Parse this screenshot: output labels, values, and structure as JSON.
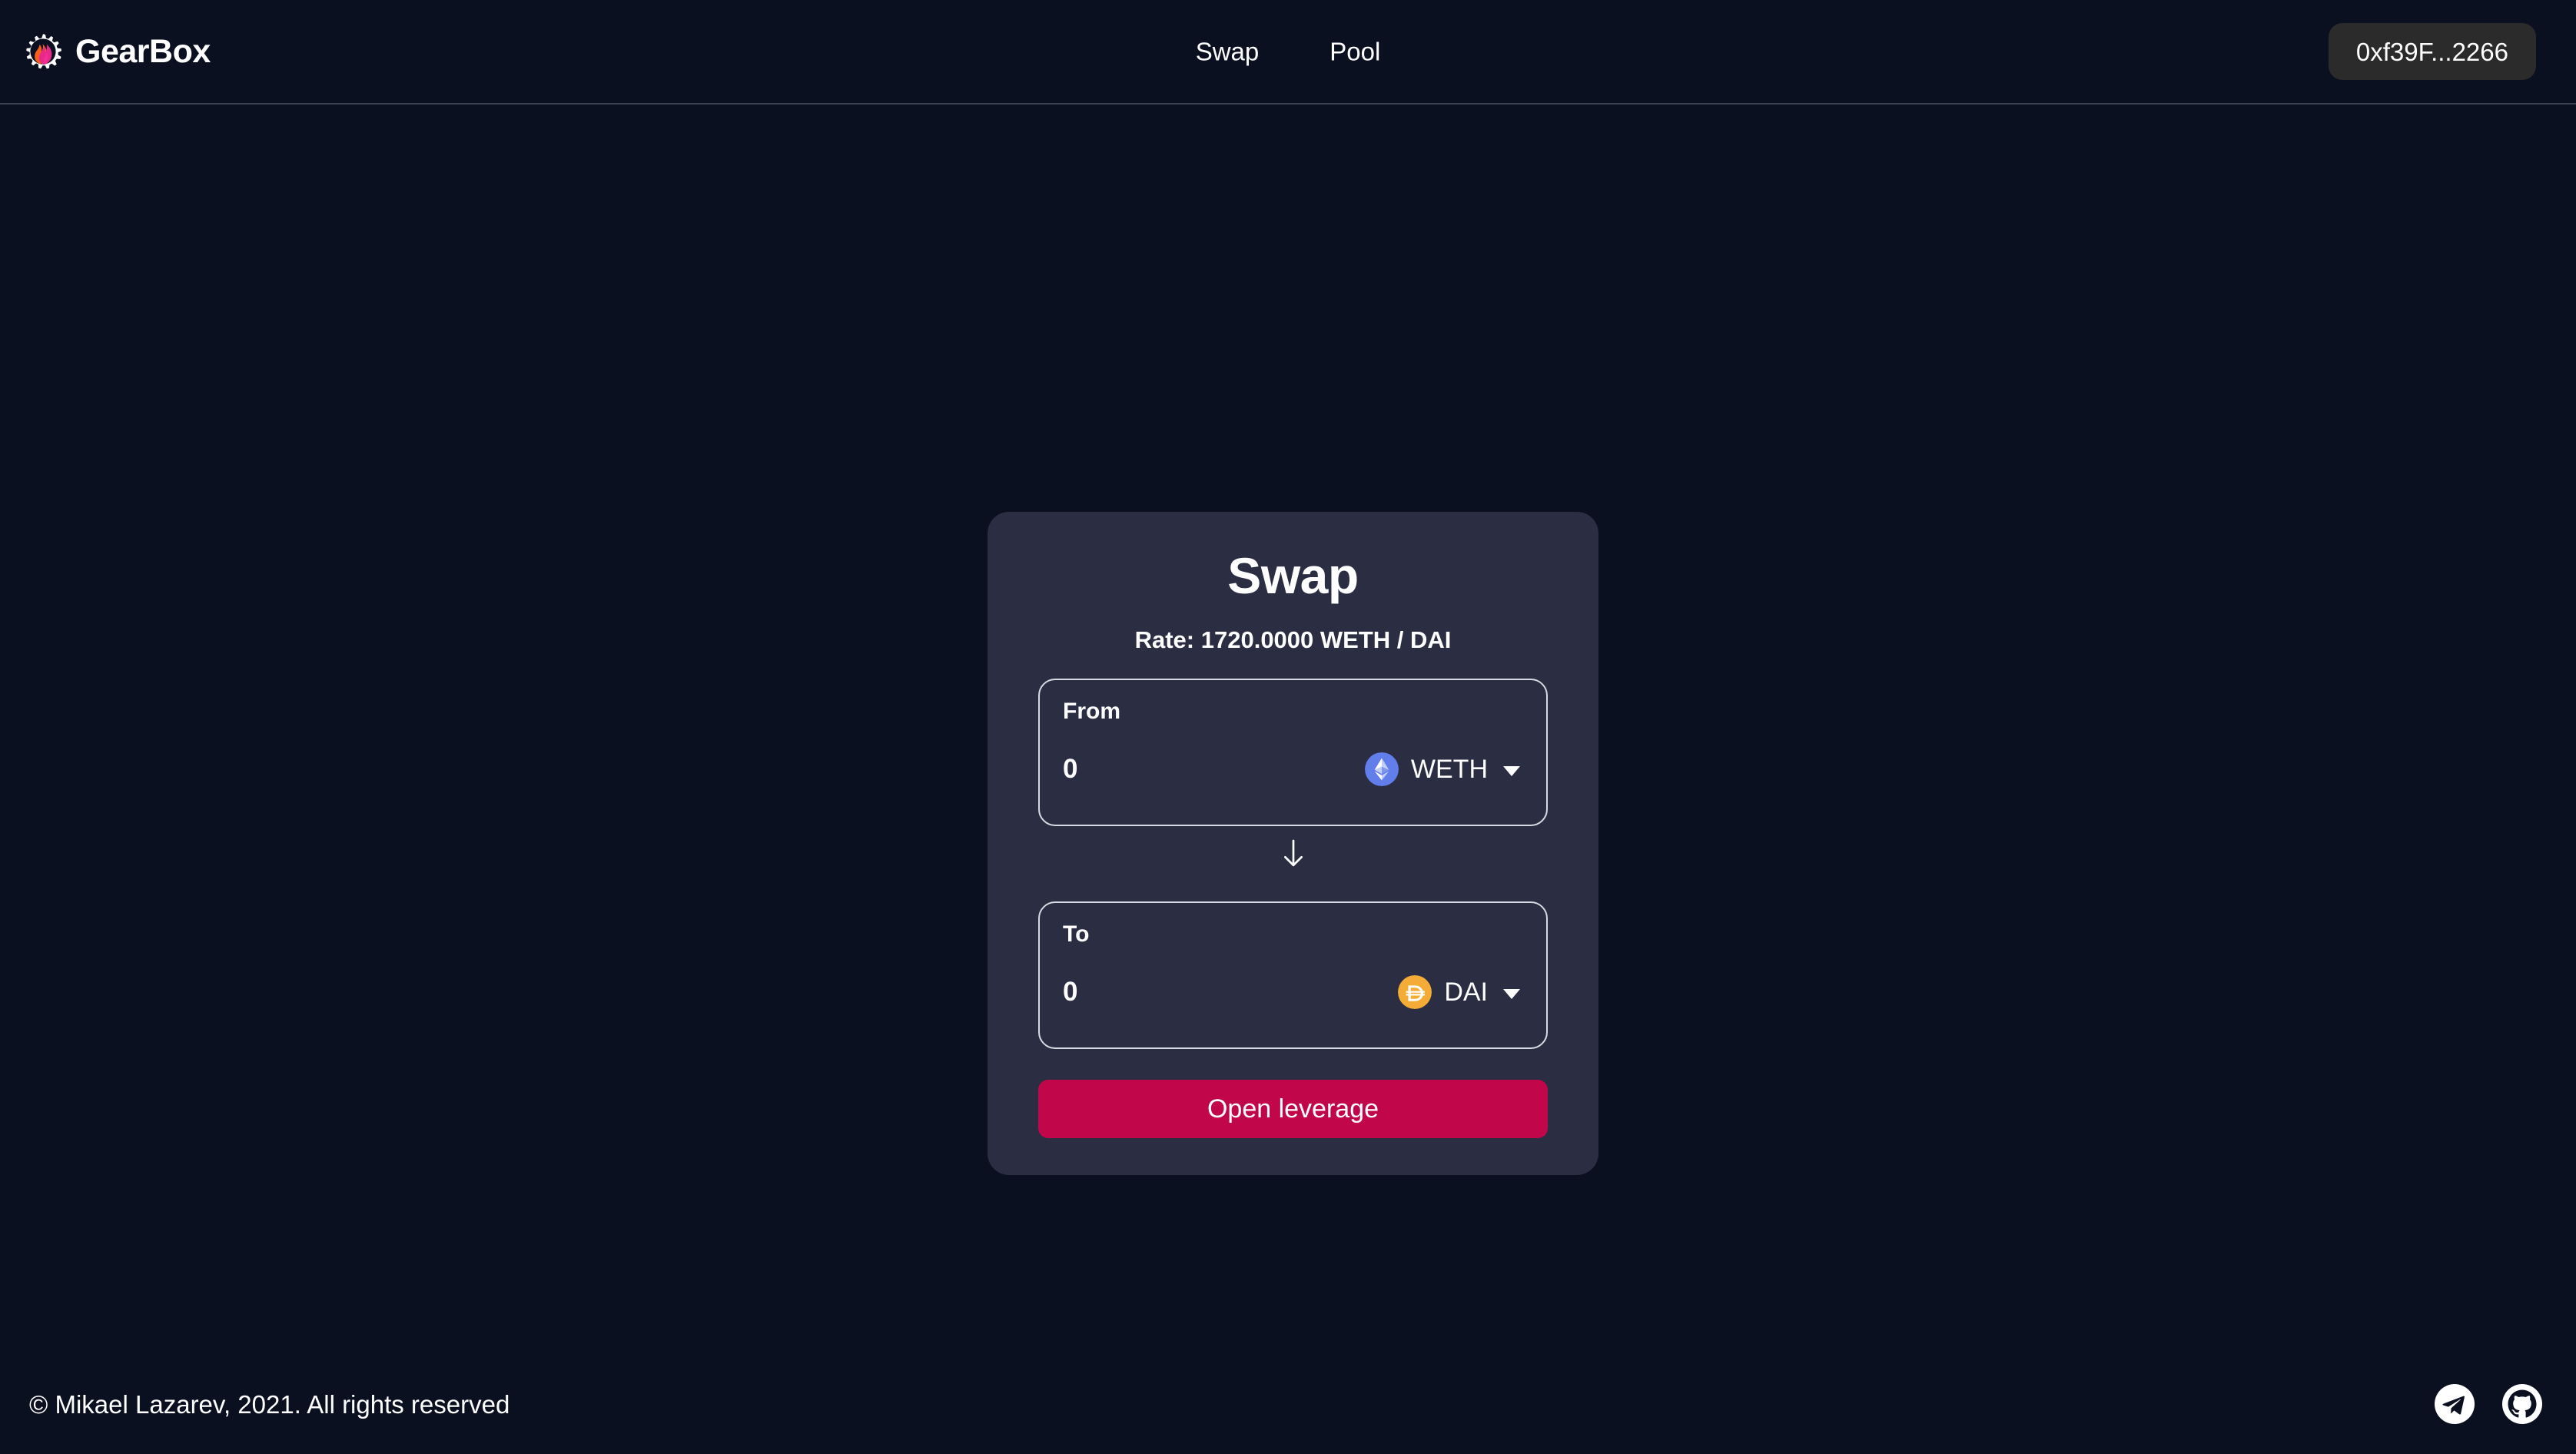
{
  "header": {
    "brand": {
      "name": "GearBox",
      "logo_icon": "gearbox-flame-gear-logo"
    },
    "nav": [
      {
        "label": "Swap",
        "icon": ""
      },
      {
        "label": "Pool",
        "icon": ""
      }
    ],
    "wallet": {
      "address_label": "0xf39F...2266"
    }
  },
  "swap_card": {
    "title": "Swap",
    "rate": "Rate: 1720.0000 WETH / DAI",
    "from": {
      "label": "From",
      "amount": "0",
      "amount_placeholder": "0",
      "token_symbol": "WETH",
      "token_icon": "ethereum-diamond-icon",
      "token_icon_color": "#627eea"
    },
    "swap_direction_icon": "arrow-down-icon",
    "to": {
      "label": "To",
      "amount": "0",
      "amount_placeholder": "0",
      "token_symbol": "DAI",
      "token_icon": "dai-coin-icon",
      "token_icon_color": "#f5ac37"
    },
    "submit_label": "Open leverage",
    "submit_color": "#c2064a"
  },
  "footer": {
    "copyright": "© Mikael Lazarev, 2021. All rights reserved",
    "socials": [
      {
        "name": "telegram",
        "icon": "telegram-icon"
      },
      {
        "name": "github",
        "icon": "github-icon"
      }
    ]
  },
  "theme": {
    "page_background": "#0b1021",
    "card_background": "#2b2d42",
    "accent": "#c2064a",
    "text_primary": "#ffffff"
  }
}
